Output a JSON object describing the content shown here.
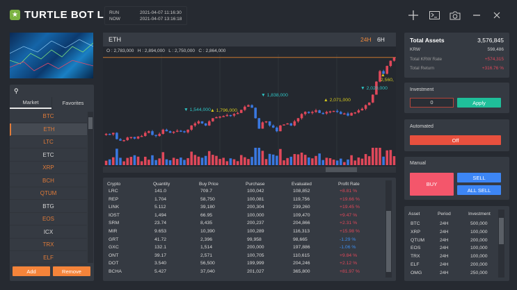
{
  "app": {
    "title": "TURTLE BOT L",
    "run_label": "RUN",
    "run_time": "2021-04-07 11:16:30",
    "now_label": "NOW",
    "now_time": "2021-04-07 13:16:18"
  },
  "window_icons": [
    "crosshair-icon",
    "terminal-icon",
    "camera-icon",
    "minimize-icon",
    "close-icon"
  ],
  "sidebar": {
    "tabs": [
      "Market",
      "Favorites"
    ],
    "active_tab": "Market",
    "selected": "ETH",
    "items": [
      {
        "label": "BTC",
        "color": "#e07b39"
      },
      {
        "label": "ETH",
        "color": "#e07b39"
      },
      {
        "label": "LTC",
        "color": "#e07b39"
      },
      {
        "label": "ETC",
        "color": "#d8d8d8"
      },
      {
        "label": "XRP",
        "color": "#e07b39"
      },
      {
        "label": "BCH",
        "color": "#e07b39"
      },
      {
        "label": "QTUM",
        "color": "#e07b39"
      },
      {
        "label": "BTG",
        "color": "#d8d8d8"
      },
      {
        "label": "EOS",
        "color": "#e07b39"
      },
      {
        "label": "ICX",
        "color": "#d8d8d8"
      },
      {
        "label": "TRX",
        "color": "#e07b39"
      },
      {
        "label": "ELF",
        "color": "#e07b39"
      }
    ],
    "add_label": "Add",
    "remove_label": "Remove"
  },
  "chart": {
    "symbol": "ETH",
    "intervals": [
      "24H",
      "6H"
    ],
    "active_interval": "24H",
    "ohlc": "O : 2,783,000   H : 2,894,000   L : 2,750,000   C : 2,864,000",
    "markers": [
      {
        "text": "▼ 1,544,000",
        "type": "high"
      },
      {
        "text": "▲ 1,796,000",
        "type": "low"
      },
      {
        "text": "▼ 1,838,000",
        "type": "high"
      },
      {
        "text": "▲ 2,071,000",
        "type": "low"
      },
      {
        "text": "▼ 2,020,000",
        "type": "high"
      },
      {
        "text": "▲ 2,560,",
        "type": "low"
      }
    ],
    "closes_thousand_krw": [
      1400,
      1390,
      1420,
      1300,
      1270,
      1280,
      1330,
      1340,
      1310,
      1350,
      1360,
      1420,
      1450,
      1380,
      1360,
      1400,
      1480,
      1450,
      1420,
      1440,
      1460,
      1450,
      1430,
      1480,
      1560,
      1600,
      1640,
      1600,
      1560,
      1640,
      1700,
      1720,
      1730,
      1740,
      1760,
      1750,
      1780,
      1800,
      1860,
      1920,
      1950,
      1900,
      1700,
      1500,
      1620,
      1640,
      1560,
      1520,
      1450,
      1560,
      1580,
      1600,
      1560,
      1640,
      1700,
      1780,
      1820,
      1800,
      1820,
      1850,
      1800,
      1790,
      1820,
      1830,
      1840,
      1820,
      1780,
      1790,
      1750,
      1800,
      1810,
      1850,
      1880,
      1950,
      2000,
      2150,
      2400,
      2600,
      2550,
      2700,
      2800,
      2864
    ],
    "up_color": "#e0485a",
    "down_color": "#3a78e0"
  },
  "holdings": {
    "headers": [
      "Crypto",
      "Quantity",
      "Buy Price",
      "Purchase",
      "Evaluated",
      "Profit Rate"
    ],
    "rows": [
      [
        "LRC",
        "141.0",
        "709.7",
        "100,042",
        "108,852",
        "+8.81 %"
      ],
      [
        "REP",
        "1.704",
        "58,750",
        "100,081",
        "119,756",
        "+19.66 %"
      ],
      [
        "LINK",
        "5.112",
        "39,180",
        "200,304",
        "239,260",
        "+19.45 %"
      ],
      [
        "IOST",
        "1,494",
        "66.95",
        "100,000",
        "109,470",
        "+9.47 %"
      ],
      [
        "SRM",
        "23.74",
        "8,435",
        "200,237",
        "204,866",
        "+2.31 %"
      ],
      [
        "MIR",
        "9.653",
        "10,390",
        "100,289",
        "116,313",
        "+15.98 %"
      ],
      [
        "GRT",
        "41.72",
        "2,396",
        "99,958",
        "98,665",
        "-1.29 %"
      ],
      [
        "GXC",
        "132.1",
        "1,514",
        "200,000",
        "197,886",
        "-1.06 %"
      ],
      [
        "ONT",
        "39.17",
        "2,571",
        "100,705",
        "110,615",
        "+9.84 %"
      ],
      [
        "DOT",
        "3.540",
        "56,500",
        "199,999",
        "204,246",
        "+2.12 %"
      ],
      [
        "BCHA",
        "5.427",
        "37,040",
        "201,027",
        "365,800",
        "+81.97 %"
      ]
    ]
  },
  "summary": {
    "total_assets_label": "Total Assets",
    "total_assets": "3,576,845",
    "krw_label": "KRW",
    "krw": "598,486",
    "krw_rate_label": "Total KRW Rate",
    "krw_rate": "+574,315",
    "return_label": "Total Return",
    "return": "+316.76 %"
  },
  "investment": {
    "label": "Investment",
    "value": "0",
    "apply_label": "Apply"
  },
  "automated": {
    "label": "Automated",
    "toggle_label": "Off"
  },
  "manual": {
    "label": "Manual",
    "buy_label": "BUY",
    "sell_label": "SELL",
    "all_sell_label": "ALL SELL"
  },
  "assets": {
    "headers": [
      "Asset",
      "Period",
      "Investment"
    ],
    "rows": [
      [
        "BTC",
        "24H",
        "500,000"
      ],
      [
        "XRP",
        "24H",
        "100,000"
      ],
      [
        "QTUM",
        "24H",
        "200,000"
      ],
      [
        "EOS",
        "24H",
        "100,000"
      ],
      [
        "TRX",
        "24H",
        "100,000"
      ],
      [
        "ELF",
        "24H",
        "200,000"
      ],
      [
        "OMG",
        "24H",
        "250,000"
      ]
    ]
  }
}
